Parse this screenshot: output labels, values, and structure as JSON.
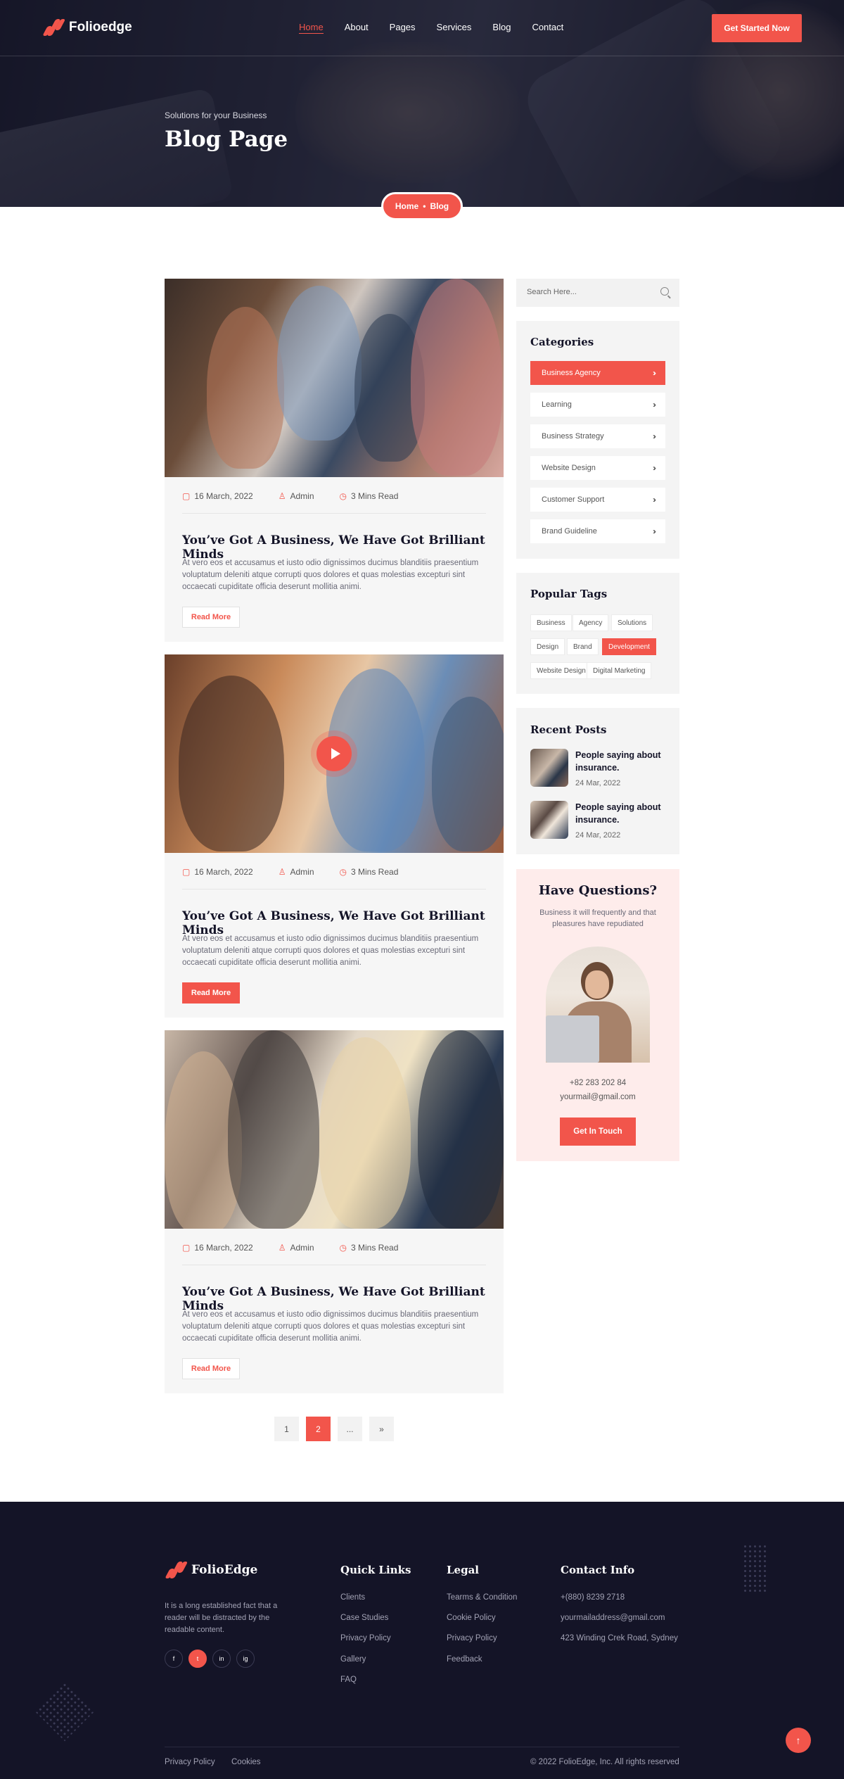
{
  "brand": {
    "name": "Folioedge",
    "footer_name": "FolioEdge",
    "accent": "#f2554b",
    "dark": "#141427"
  },
  "nav": {
    "items": [
      "Home",
      "About",
      "Pages",
      "Services",
      "Blog",
      "Contact"
    ],
    "active": "Home",
    "cta": "Get Started Now"
  },
  "hero": {
    "subtitle": "Solutions for your Business",
    "title": "Blog Page",
    "breadcrumb": {
      "home": "Home",
      "sep": "•",
      "current": "Blog"
    }
  },
  "posts": [
    {
      "date": "16 March, 2022",
      "author": "Admin",
      "read": "3 Mins Read",
      "title": "You’ve Got A Business, We Have Got Brilliant Minds",
      "excerpt": "At vero eos et accusamus et iusto odio dignissimos ducimus blanditiis praesentium voluptatum deleniti atque corrupti quos dolores et quas molestias excepturi sint occaecati cupiditate officia deserunt mollitia animi.",
      "button": "Read More"
    },
    {
      "date": "16 March, 2022",
      "author": "Admin",
      "read": "3 Mins Read",
      "title": "You’ve Got A Business, We Have Got Brilliant Minds",
      "excerpt": "At vero eos et accusamus et iusto odio dignissimos ducimus blanditiis praesentium voluptatum deleniti atque corrupti quos dolores et quas molestias excepturi sint occaecati cupiditate officia deserunt mollitia animi.",
      "button": "Read More"
    },
    {
      "date": "16 March, 2022",
      "author": "Admin",
      "read": "3 Mins Read",
      "title": "You’ve Got A Business, We Have Got Brilliant Minds",
      "excerpt": "At vero eos et accusamus et iusto odio dignissimos ducimus blanditiis praesentium voluptatum deleniti atque corrupti quos dolores et quas molestias excepturi sint occaecati cupiditate officia deserunt mollitia animi.",
      "button": "Read More"
    }
  ],
  "pagination": {
    "items": [
      "1",
      "2",
      "...",
      "»"
    ],
    "current": "2"
  },
  "sidebar": {
    "search_placeholder": "Search Here...",
    "categories_title": "Categories",
    "categories": [
      "Business Agency",
      "Learning",
      "Business Strategy",
      "Website Design",
      "Customer Support",
      "Brand Guideline"
    ],
    "active_category": "Business Agency",
    "tags_title": "Popular Tags",
    "tags": [
      "Business",
      "Agency",
      "Solutions",
      "Design",
      "Brand",
      "Development",
      "Website Design",
      "Digital Marketing"
    ],
    "active_tag": "Development",
    "recent_title": "Recent Posts",
    "recent": [
      {
        "title": "People saying about insurance.",
        "date": "24 Mar, 2022"
      },
      {
        "title": "People saying about insurance.",
        "date": "24 Mar, 2022"
      }
    ],
    "help": {
      "title": "Have Questions?",
      "desc": "Business it will frequently and that pleasures have repudiated",
      "phone": "+82 283 202 84",
      "email": "yourmail@gmail.com",
      "button": "Get In Touch"
    }
  },
  "footer": {
    "desc": "It is a long established fact that a reader will be distracted by the readable content.",
    "social": [
      "f",
      "t",
      "in",
      "ig"
    ],
    "quick_title": "Quick Links",
    "quick": [
      "Clients",
      "Case Studies",
      "Privacy Policy",
      "Gallery",
      "FAQ"
    ],
    "legal_title": "Legal",
    "legal": [
      "Tearms & Condition",
      "Cookie Policy",
      "Privacy Policy",
      "Feedback"
    ],
    "contact_title": "Contact Info",
    "contact": [
      "+(880) 8239 2718",
      "yourmailaddress@gmail.com",
      "423 Winding Crek Road, Sydney"
    ],
    "bottom_links": [
      "Privacy Policy",
      "Cookies"
    ],
    "copyright": "© 2022 FolioEdge, Inc. All rights reserved"
  }
}
